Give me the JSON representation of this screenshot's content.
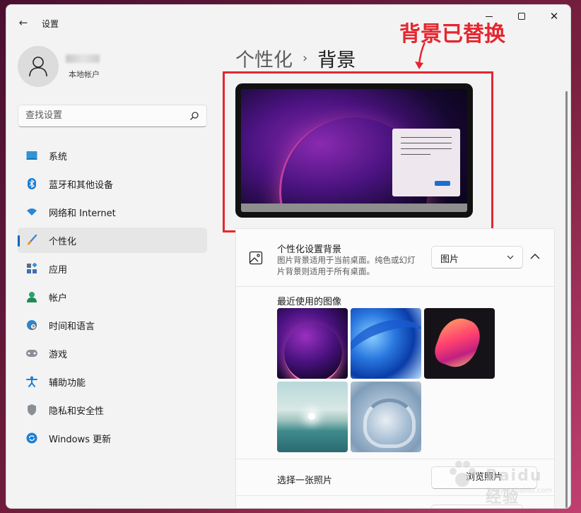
{
  "window": {
    "app_title": "设置",
    "back_icon": "back-arrow-icon"
  },
  "account": {
    "type": "本地帐户"
  },
  "search": {
    "placeholder": "查找设置"
  },
  "sidebar": {
    "items": [
      {
        "label": "系统",
        "icon": "system-display-icon",
        "active": false
      },
      {
        "label": "蓝牙和其他设备",
        "icon": "bluetooth-icon",
        "active": false
      },
      {
        "label": "网络和 Internet",
        "icon": "wifi-icon",
        "active": false
      },
      {
        "label": "个性化",
        "icon": "paintbrush-icon",
        "active": true
      },
      {
        "label": "应用",
        "icon": "apps-icon",
        "active": false
      },
      {
        "label": "帐户",
        "icon": "account-icon",
        "active": false
      },
      {
        "label": "时间和语言",
        "icon": "globe-clock-icon",
        "active": false
      },
      {
        "label": "游戏",
        "icon": "gamepad-icon",
        "active": false
      },
      {
        "label": "辅助功能",
        "icon": "accessibility-icon",
        "active": false
      },
      {
        "label": "隐私和安全性",
        "icon": "shield-icon",
        "active": false
      },
      {
        "label": "Windows 更新",
        "icon": "update-icon",
        "active": false
      }
    ]
  },
  "breadcrumb": {
    "parent": "个性化",
    "separator": "›",
    "current": "背景"
  },
  "annotation": {
    "text": "背景已替换",
    "color": "#e5262f"
  },
  "background_setting": {
    "title": "个性化设置背景",
    "description": "图片背景适用于当前桌面。纯色或幻灯片背景则适用于所有桌面。",
    "dropdown_value": "图片"
  },
  "recent_images": {
    "label": "最近使用的图像"
  },
  "choose_photo": {
    "label": "选择一张照片",
    "button_label": "浏览照片"
  },
  "watermark": {
    "text": "Baidu 经验",
    "sub": "jingyan.baidu.com"
  },
  "colors": {
    "accent": "#0067c0",
    "annotation_red": "#e5262f"
  }
}
